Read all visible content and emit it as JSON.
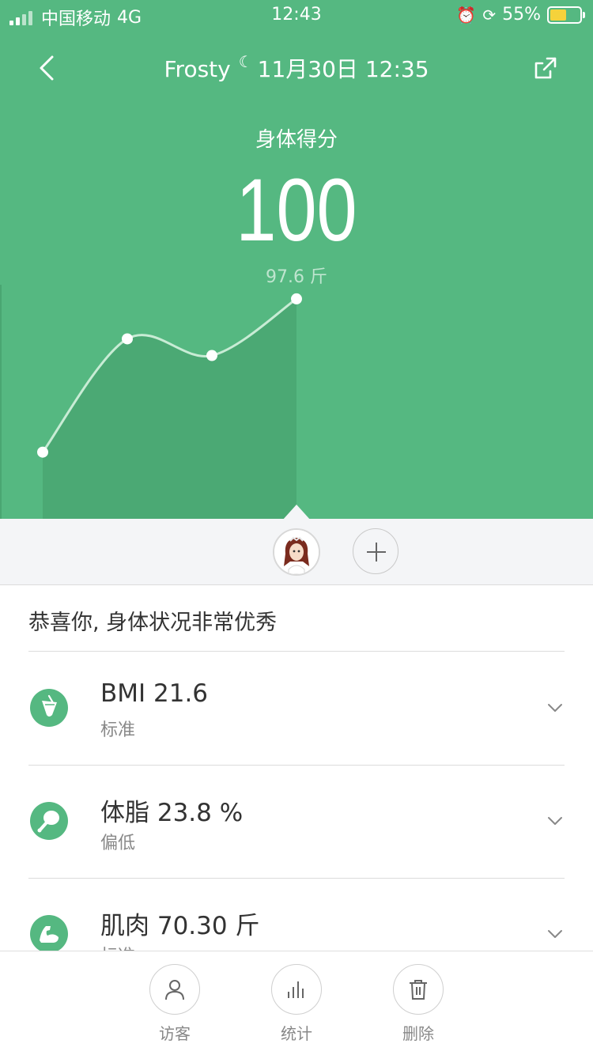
{
  "status_bar": {
    "carrier": "中国移动",
    "network": "4G",
    "time": "12:43",
    "battery_percent": "55%",
    "battery_level": 0.55,
    "colors": {
      "battery_fill": "#f5d23b"
    }
  },
  "nav": {
    "title_name": "Frosty",
    "title_date": "11月30日 12:35"
  },
  "score": {
    "label": "身体得分",
    "value": "100",
    "weight": "97.6 斤"
  },
  "chart_data": {
    "type": "area",
    "x": [
      1,
      2,
      3,
      4
    ],
    "values": [
      40,
      108,
      98,
      132
    ],
    "ylim": [
      0,
      150
    ],
    "grid": false
  },
  "summary": {
    "text": "恭喜你, 身体状况非常优秀"
  },
  "metrics": [
    {
      "title": "BMI 21.6",
      "status": "标准",
      "icon": "cup-icon"
    },
    {
      "title": "体脂 23.8 %",
      "status": "偏低",
      "icon": "drumstick-icon"
    },
    {
      "title": "肌肉 70.30 斤",
      "status": "标准",
      "icon": "muscle-arm-icon"
    }
  ],
  "bottom_tabs": [
    {
      "label": "访客",
      "icon": "person-icon"
    },
    {
      "label": "统计",
      "icon": "bar-chart-icon"
    },
    {
      "label": "删除",
      "icon": "trash-icon"
    }
  ],
  "colors": {
    "accent": "#55b881",
    "chart_fill": "#4aa672",
    "line": "#c8ecd5"
  }
}
